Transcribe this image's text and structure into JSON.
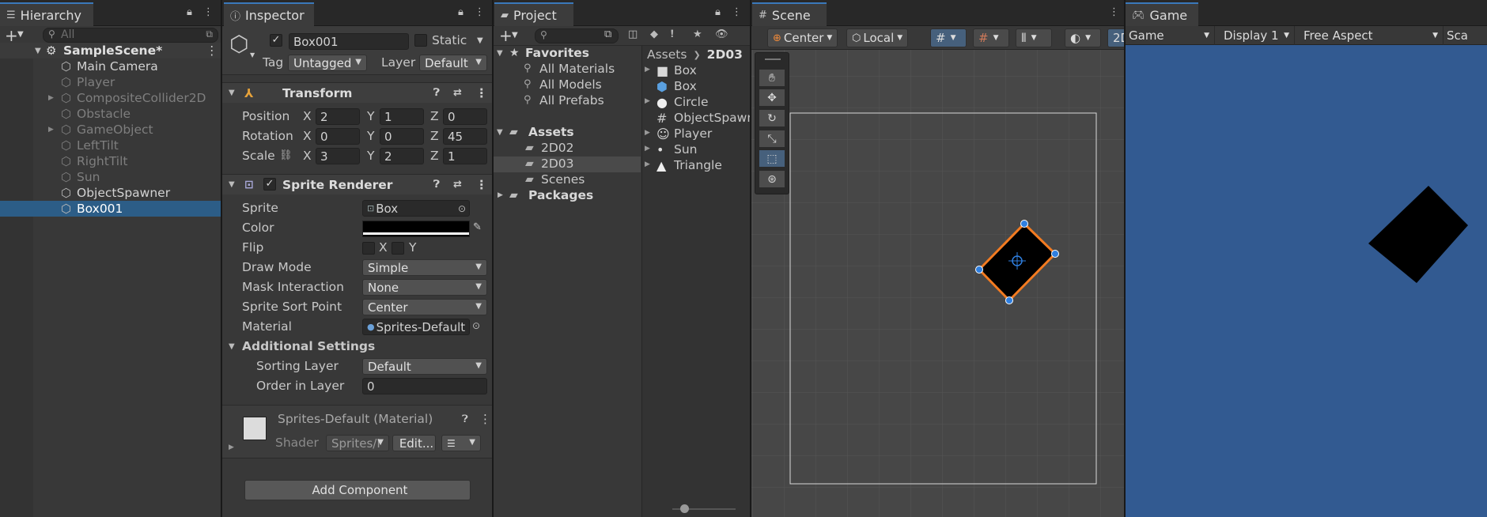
{
  "hierarchy": {
    "tab_label": "Hierarchy",
    "search_placeholder": "All",
    "scene_name": "SampleScene*",
    "items": [
      {
        "label": "Main Camera",
        "dim": false,
        "expandable": false
      },
      {
        "label": "Player",
        "dim": true,
        "expandable": false
      },
      {
        "label": "CompositeCollider2D",
        "dim": true,
        "expandable": true
      },
      {
        "label": "Obstacle",
        "dim": true,
        "expandable": false
      },
      {
        "label": "GameObject",
        "dim": true,
        "expandable": true
      },
      {
        "label": "LeftTilt",
        "dim": true,
        "expandable": false
      },
      {
        "label": "RightTilt",
        "dim": true,
        "expandable": false
      },
      {
        "label": "Sun",
        "dim": true,
        "expandable": false
      },
      {
        "label": "ObjectSpawner",
        "dim": false,
        "expandable": false
      },
      {
        "label": "Box001",
        "dim": false,
        "expandable": false,
        "selected": true
      }
    ]
  },
  "inspector": {
    "tab_label": "Inspector",
    "object_name": "Box001",
    "static_label": "Static",
    "tag_label": "Tag",
    "tag_value": "Untagged",
    "layer_label": "Layer",
    "layer_value": "Default",
    "transform": {
      "title": "Transform",
      "position_label": "Position",
      "rotation_label": "Rotation",
      "scale_label": "Scale",
      "position": {
        "x": "2",
        "y": "1",
        "z": "0"
      },
      "rotation": {
        "x": "0",
        "y": "0",
        "z": "45"
      },
      "scale": {
        "x": "3",
        "y": "2",
        "z": "1"
      },
      "axis_x": "X",
      "axis_y": "Y",
      "axis_z": "Z"
    },
    "sprite_renderer": {
      "title": "Sprite Renderer",
      "sprite_label": "Sprite",
      "sprite_value": "Box",
      "color_label": "Color",
      "flip_label": "Flip",
      "flip_x": "X",
      "flip_y": "Y",
      "draw_mode_label": "Draw Mode",
      "draw_mode_value": "Simple",
      "mask_label": "Mask Interaction",
      "mask_value": "None",
      "sort_point_label": "Sprite Sort Point",
      "sort_point_value": "Center",
      "material_label": "Material",
      "material_value": "Sprites-Default",
      "additional_label": "Additional Settings",
      "sorting_layer_label": "Sorting Layer",
      "sorting_layer_value": "Default",
      "order_label": "Order in Layer",
      "order_value": "0"
    },
    "material": {
      "title": "Sprites-Default (Material)",
      "shader_label": "Shader",
      "shader_value": "Sprites/I",
      "edit_label": "Edit..."
    },
    "add_component_label": "Add Component"
  },
  "project": {
    "tab_label": "Project",
    "favorites_label": "Favorites",
    "favorites": [
      "All Materials",
      "All Models",
      "All Prefabs"
    ],
    "assets_label": "Assets",
    "asset_folders": [
      "2D02",
      "2D03",
      "Scenes"
    ],
    "packages_label": "Packages",
    "breadcrumb_root": "Assets",
    "breadcrumb_current": "2D03",
    "files": [
      "Box",
      "Box",
      "Circle",
      "ObjectSpawn",
      "Player",
      "Sun",
      "Triangle"
    ]
  },
  "scene": {
    "tab_label": "Scene",
    "pivot_label": "Center",
    "space_label": "Local",
    "mode_2d_label": "2D"
  },
  "game": {
    "tab_label": "Game",
    "view_label": "Game",
    "display_label": "Display 1",
    "aspect_label": "Free Aspect",
    "scale_label": "Sca"
  },
  "colors": {
    "selection": "#2c5d87",
    "game_bg": "#325a91",
    "scene_bg": "#474747",
    "outline": "#f37b21",
    "handle": "#2f7fe0"
  }
}
